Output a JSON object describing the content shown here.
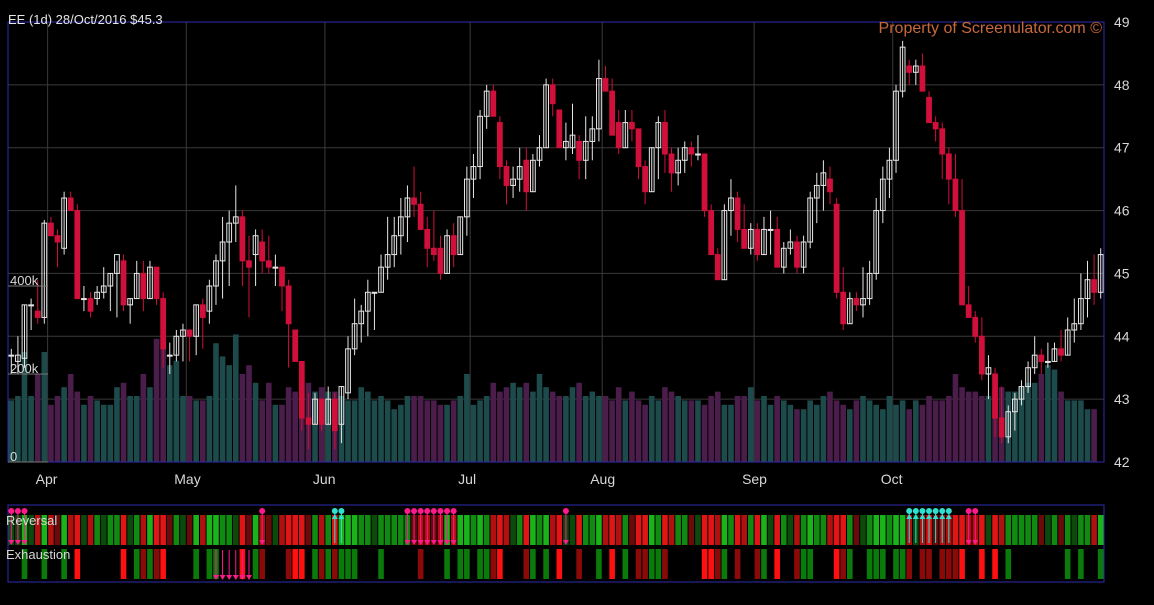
{
  "header": {
    "symbol_line": "EE (1d) 28/Oct/2016 $45.3",
    "watermark": "Property of Screenulator.com ©"
  },
  "panels": {
    "reversal_label": "Reversal",
    "exhaustion_label": "Exhaustion"
  },
  "colors": {
    "up_candle": "#e6e6e6",
    "down_candle": "#d0103a",
    "grid": "#3a3a3a",
    "frame": "#2d2db0",
    "text": "#d8d8d8",
    "watermark": "#c8693a",
    "vol_up": "#1d4a4a",
    "vol_down": "#4a1d4a",
    "marker_pink": "#ff1a8c",
    "marker_cyan": "#30e0d0"
  },
  "chart_data": {
    "type": "candlestick",
    "title": "EE (1d) 28/Oct/2016 $45.3",
    "ylim": [
      42,
      49
    ],
    "y_ticks": [
      "42",
      "43",
      "44",
      "45",
      "46",
      "47",
      "48",
      "49"
    ],
    "volume_ticks": [
      "0",
      "200k",
      "400k"
    ],
    "volume_max": 1000000,
    "x_labels": [
      "Apr",
      "May",
      "Jun",
      "Jul",
      "Aug",
      "Sep",
      "Oct"
    ],
    "x_label_index": [
      6,
      27,
      48,
      70,
      90,
      113,
      134
    ],
    "ohlc": [
      [
        43.7,
        43.8,
        43.4,
        43.7
      ],
      [
        43.6,
        44,
        43.4,
        43.7
      ],
      [
        43.65,
        44.5,
        43.5,
        44.5
      ],
      [
        44.5,
        44.6,
        44.1,
        44.5
      ],
      [
        44.4,
        44.9,
        44.2,
        44.3
      ],
      [
        44.3,
        45.85,
        44.2,
        45.8
      ],
      [
        45.8,
        45.9,
        45.6,
        45.6
      ],
      [
        45.6,
        45.7,
        45.1,
        45.5
      ],
      [
        45.4,
        46.3,
        45.3,
        46.2
      ],
      [
        46.2,
        46.3,
        46,
        46.0
      ],
      [
        46,
        46.1,
        44.7,
        44.6
      ],
      [
        44.6,
        44.8,
        44.4,
        44.6
      ],
      [
        44.6,
        44.7,
        44.3,
        44.4
      ],
      [
        44.6,
        44.8,
        44.5,
        44.7
      ],
      [
        44.7,
        45.1,
        44.6,
        44.8
      ],
      [
        44.8,
        45,
        44.4,
        45.0
      ],
      [
        45,
        45.2,
        44.3,
        45.3
      ],
      [
        45.2,
        45.3,
        44.4,
        44.5
      ],
      [
        44.5,
        44.6,
        44.2,
        44.6
      ],
      [
        44.6,
        45.2,
        44.6,
        45.0
      ],
      [
        45,
        45.2,
        44.4,
        44.6
      ],
      [
        44.6,
        45.2,
        44.6,
        45.1
      ],
      [
        45.1,
        44.6,
        44.5,
        44.6
      ],
      [
        44.6,
        44.7,
        43.5,
        43.8
      ],
      [
        43.7,
        43.9,
        43.4,
        43.7
      ],
      [
        43.7,
        44.1,
        43.6,
        44.0
      ],
      [
        44,
        44.2,
        43.6,
        44.1
      ],
      [
        44.1,
        44.1,
        43.6,
        44.0
      ],
      [
        44,
        44.5,
        43.7,
        44.5
      ],
      [
        44.5,
        44.6,
        43.8,
        44.3
      ],
      [
        44.4,
        44.9,
        44.2,
        44.8
      ],
      [
        44.8,
        45.3,
        44.5,
        45.2
      ],
      [
        45.2,
        45.9,
        44.6,
        45.5
      ],
      [
        45.5,
        46,
        44.8,
        45.8
      ],
      [
        45.8,
        46.4,
        45.5,
        45.9
      ],
      [
        45.9,
        46,
        44.8,
        45.2
      ],
      [
        45.2,
        45.6,
        44.3,
        45.1
      ],
      [
        45.3,
        45.7,
        44.8,
        45.6
      ],
      [
        45.5,
        45.7,
        45.0,
        45.2
      ],
      [
        45.2,
        45.6,
        45,
        45.1
      ],
      [
        45.1,
        45.3,
        44.8,
        45.1
      ],
      [
        45.1,
        45.0,
        44.4,
        44.8
      ],
      [
        44.8,
        44.9,
        43.5,
        44.2
      ],
      [
        44.1,
        43.9,
        43.6,
        43.6
      ],
      [
        43.6,
        43.5,
        42.5,
        42.7
      ],
      [
        42.7,
        43.1,
        42.2,
        42.6
      ],
      [
        42.6,
        43.1,
        42.6,
        43.0
      ],
      [
        43.0,
        43.0,
        42.5,
        42.6
      ],
      [
        42.6,
        43.2,
        42.6,
        43.0
      ],
      [
        43.0,
        43.1,
        42.2,
        42.5
      ],
      [
        42.6,
        43.2,
        42.3,
        43.2
      ],
      [
        43.1,
        44,
        43,
        43.8
      ],
      [
        43.8,
        44.6,
        43.7,
        44.2
      ],
      [
        44.2,
        44.5,
        43.9,
        44.4
      ],
      [
        44.4,
        44.9,
        44.0,
        44.7
      ],
      [
        44.7,
        44.7,
        44.1,
        44.7
      ],
      [
        44.7,
        45.3,
        44.7,
        45.1
      ],
      [
        45.1,
        45.9,
        44.9,
        45.3
      ],
      [
        45.3,
        45.9,
        45.1,
        45.6
      ],
      [
        45.6,
        46.2,
        45.3,
        45.9
      ],
      [
        45.9,
        46.4,
        45.5,
        46.2
      ],
      [
        46.2,
        46.7,
        45.9,
        46.1
      ],
      [
        46.1,
        46.3,
        45.7,
        45.7
      ],
      [
        45.7,
        45.9,
        45.1,
        45.4
      ],
      [
        45.4,
        46,
        45.2,
        45.3
      ],
      [
        45.4,
        45.6,
        44.9,
        45.0
      ],
      [
        45.0,
        45.7,
        45.0,
        45.6
      ],
      [
        45.6,
        45.8,
        45.1,
        45.3
      ],
      [
        45.3,
        45.9,
        45.3,
        45.9
      ],
      [
        45.9,
        46.7,
        45.6,
        46.5
      ],
      [
        46.5,
        46.9,
        46.2,
        46.7
      ],
      [
        46.7,
        47.6,
        46.5,
        47.5
      ],
      [
        47.5,
        48,
        47.3,
        47.9
      ],
      [
        47.9,
        48,
        47.6,
        47.5
      ],
      [
        47.4,
        47.5,
        46.5,
        46.7
      ],
      [
        46.7,
        46.8,
        46.1,
        46.4
      ],
      [
        46.4,
        46.7,
        46.2,
        46.5
      ],
      [
        46.5,
        47,
        46.3,
        46.7
      ],
      [
        46.8,
        47.0,
        46.0,
        46.3
      ],
      [
        46.3,
        46.9,
        46.3,
        46.8
      ],
      [
        46.8,
        47.2,
        46.7,
        47.0
      ],
      [
        47.0,
        48.1,
        47,
        48.0
      ],
      [
        48,
        48.1,
        47.5,
        47.7
      ],
      [
        47.6,
        47.5,
        47.0,
        47.0
      ],
      [
        47.0,
        47.4,
        46.8,
        47.1
      ],
      [
        47,
        47.7,
        46.9,
        47.2
      ],
      [
        47.1,
        47.2,
        46.5,
        46.8
      ],
      [
        46.8,
        47.5,
        46.5,
        47.1
      ],
      [
        47.1,
        47.5,
        46.8,
        47.3
      ],
      [
        47.3,
        48.4,
        47.1,
        48.1
      ],
      [
        48.1,
        48.3,
        47.9,
        47.9
      ],
      [
        47.9,
        48.1,
        47.3,
        47.2
      ],
      [
        47.4,
        47.6,
        46.9,
        47.0
      ],
      [
        47.0,
        47.6,
        47.0,
        47.4
      ],
      [
        47.4,
        47.6,
        47.1,
        47.3
      ],
      [
        47.3,
        47.3,
        46.5,
        46.7
      ],
      [
        46.7,
        46.8,
        46.1,
        46.3
      ],
      [
        46.3,
        47.0,
        46.3,
        47.0
      ],
      [
        47,
        47.5,
        46.5,
        47.4
      ],
      [
        47.4,
        47.6,
        46.6,
        46.9
      ],
      [
        46.9,
        47.0,
        46.3,
        46.6
      ],
      [
        46.6,
        47.0,
        46.4,
        46.8
      ],
      [
        46.8,
        47.1,
        46.6,
        47.0
      ],
      [
        47,
        47.1,
        46.7,
        46.9
      ],
      [
        46.9,
        47.2,
        46.8,
        46.9
      ],
      [
        46.9,
        46.9,
        45.9,
        46.0
      ],
      [
        46.0,
        46.1,
        45.3,
        45.3
      ],
      [
        45.3,
        45.4,
        44.9,
        44.9
      ],
      [
        44.9,
        46.1,
        44.9,
        46.0
      ],
      [
        46.0,
        46.5,
        45.6,
        46.2
      ],
      [
        46.2,
        46.3,
        45.5,
        45.7
      ],
      [
        45.7,
        46.1,
        45.4,
        45.4
      ],
      [
        45.4,
        45.8,
        45.3,
        45.7
      ],
      [
        45.7,
        45.8,
        45.2,
        45.3
      ],
      [
        45.3,
        45.9,
        45.3,
        45.7
      ],
      [
        45.7,
        46,
        45.3,
        45.7
      ],
      [
        45.7,
        45.9,
        45.1,
        45.1
      ],
      [
        45.1,
        45.5,
        45.0,
        45.4
      ],
      [
        45.4,
        45.7,
        45.3,
        45.5
      ],
      [
        45.5,
        45.6,
        45.0,
        45.1
      ],
      [
        45.1,
        45.6,
        45.0,
        45.5
      ],
      [
        45.5,
        46.3,
        45.4,
        46.2
      ],
      [
        46.2,
        46.6,
        45.8,
        46.4
      ],
      [
        46.4,
        46.8,
        46.0,
        46.6
      ],
      [
        46.5,
        46.7,
        46.1,
        46.3
      ],
      [
        46.1,
        46.2,
        44.6,
        44.7
      ],
      [
        44.7,
        45.1,
        44.1,
        44.2
      ],
      [
        44.2,
        44.7,
        44.2,
        44.6
      ],
      [
        44.6,
        44.7,
        44.4,
        44.5
      ],
      [
        44.5,
        45.1,
        44.3,
        44.6
      ],
      [
        44.6,
        45.2,
        44.5,
        45.0
      ],
      [
        45,
        46.2,
        44.9,
        46.0
      ],
      [
        46,
        46.7,
        45.8,
        46.5
      ],
      [
        46.5,
        47.0,
        46.2,
        46.8
      ],
      [
        46.8,
        48.0,
        46.6,
        47.9
      ],
      [
        47.9,
        48.7,
        47.8,
        48.6
      ],
      [
        48.3,
        48.4,
        48.0,
        48.2
      ],
      [
        48.2,
        48.4,
        48.0,
        48.3
      ],
      [
        48.3,
        48.5,
        47.9,
        47.9
      ],
      [
        47.8,
        47.9,
        47.5,
        47.4
      ],
      [
        47.4,
        47.5,
        47.1,
        47.3
      ],
      [
        47.3,
        47.4,
        46.5,
        46.9
      ],
      [
        46.9,
        47.0,
        46.1,
        46.5
      ],
      [
        46.5,
        46.9,
        45.9,
        46.0
      ],
      [
        46.0,
        46.5,
        44.5,
        44.5
      ],
      [
        44.5,
        44.8,
        44.3,
        44.3
      ],
      [
        44.3,
        44.4,
        43.9,
        44.0
      ],
      [
        44,
        44.3,
        43.3,
        43.4
      ],
      [
        43.4,
        43.7,
        43,
        43.5
      ],
      [
        43.4,
        43.5,
        42.4,
        42.7
      ],
      [
        42.7,
        43.2,
        42.3,
        42.4
      ],
      [
        42.4,
        42.9,
        42.3,
        42.8
      ],
      [
        42.8,
        43.1,
        42.5,
        43.0
      ],
      [
        43.0,
        43.3,
        42.9,
        43.2
      ],
      [
        43.2,
        43.6,
        43.1,
        43.5
      ],
      [
        43.5,
        44.0,
        43.4,
        43.7
      ],
      [
        43.7,
        43.8,
        43.4,
        43.6
      ],
      [
        43.6,
        43.9,
        43.5,
        43.6
      ],
      [
        43.6,
        43.9,
        43.6,
        43.8
      ],
      [
        43.8,
        44.1,
        43.6,
        43.7
      ],
      [
        43.7,
        44.3,
        43.7,
        44.1
      ],
      [
        44.1,
        44.6,
        43.9,
        44.2
      ],
      [
        44.2,
        45.0,
        44.1,
        44.6
      ],
      [
        44.6,
        45.2,
        44.3,
        44.9
      ],
      [
        44.9,
        45.3,
        44.5,
        44.7
      ],
      [
        44.7,
        45.4,
        44.6,
        45.3
      ]
    ],
    "volume": [
      140000,
      150000,
      250000,
      150000,
      200000,
      250000,
      130000,
      150000,
      170000,
      200000,
      160000,
      130000,
      150000,
      140000,
      130000,
      130000,
      170000,
      180000,
      150000,
      150000,
      200000,
      170000,
      280000,
      260000,
      220000,
      230000,
      150000,
      150000,
      140000,
      140000,
      150000,
      270000,
      240000,
      220000,
      290000,
      200000,
      220000,
      180000,
      140000,
      180000,
      130000,
      130000,
      170000,
      160000,
      170000,
      180000,
      160000,
      170000,
      160000,
      160000,
      150000,
      140000,
      140000,
      170000,
      160000,
      140000,
      150000,
      140000,
      120000,
      130000,
      150000,
      150000,
      150000,
      140000,
      140000,
      130000,
      130000,
      140000,
      150000,
      200000,
      130000,
      140000,
      150000,
      180000,
      160000,
      170000,
      180000,
      170000,
      180000,
      160000,
      200000,
      170000,
      160000,
      150000,
      150000,
      170000,
      180000,
      150000,
      160000,
      150000,
      150000,
      140000,
      170000,
      140000,
      160000,
      140000,
      130000,
      150000,
      140000,
      170000,
      160000,
      150000,
      140000,
      140000,
      140000,
      130000,
      150000,
      160000,
      130000,
      130000,
      150000,
      150000,
      170000,
      140000,
      150000,
      130000,
      150000,
      140000,
      130000,
      120000,
      120000,
      140000,
      130000,
      150000,
      160000,
      140000,
      130000,
      120000,
      140000,
      150000,
      140000,
      130000,
      120000,
      150000,
      130000,
      140000,
      120000,
      140000,
      130000,
      150000,
      140000,
      140000,
      150000,
      200000,
      170000,
      160000,
      160000,
      150000,
      150000,
      160000,
      170000,
      160000,
      160000,
      170000,
      180000,
      180000,
      200000,
      220000,
      210000,
      160000,
      140000,
      140000,
      140000,
      120000,
      120000
    ]
  }
}
